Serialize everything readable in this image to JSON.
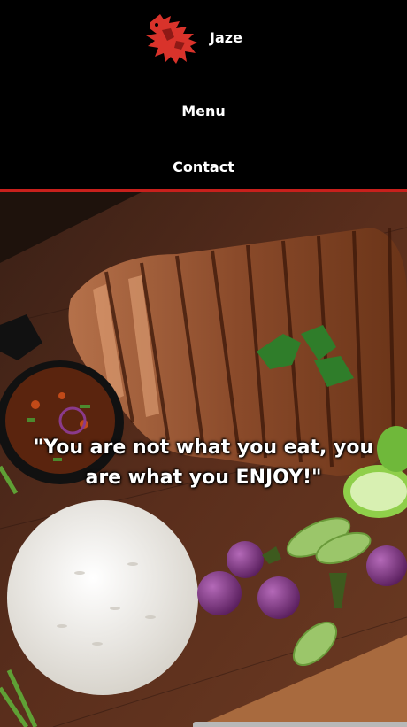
{
  "brand": {
    "name": "Jaze",
    "logo_icon": "dragon-logo-icon",
    "logo_color": "#d9332b"
  },
  "nav": {
    "menu_label": "Menu",
    "contact_label": "Contact"
  },
  "hero": {
    "quote": "\"You are not what you eat, you are what you ENJOY!\"",
    "image_icon": "grilled-pork-rice-dish-image"
  },
  "colors": {
    "accent": "#c8201c",
    "background": "#000000",
    "text": "#ffffff"
  }
}
